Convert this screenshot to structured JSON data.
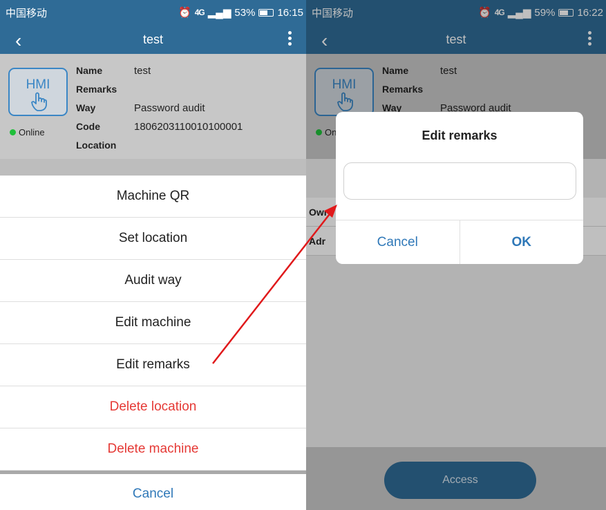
{
  "status_left": {
    "carrier": "中国移动",
    "network": "4G",
    "battery_pct": "53%",
    "battery_level": 0.53,
    "time": "16:15"
  },
  "status_right": {
    "carrier": "中国移动",
    "network": "4G",
    "battery_pct": "59%",
    "battery_level": 0.59,
    "time": "16:22"
  },
  "nav": {
    "title": "test",
    "back_icon": "chevron-left-icon",
    "more_icon": "more-vertical-icon"
  },
  "device": {
    "logo_text": "HMI",
    "status": "Online",
    "fields": [
      {
        "label": "Name",
        "value": "test"
      },
      {
        "label": "Remarks",
        "value": ""
      },
      {
        "label": "Way",
        "value": "Password audit"
      },
      {
        "label": "Code",
        "value": "1806203110010100001"
      },
      {
        "label": "Location",
        "value": ""
      }
    ]
  },
  "menu": {
    "items": [
      {
        "label": "Machine QR",
        "danger": false
      },
      {
        "label": "Set location",
        "danger": false
      },
      {
        "label": "Audit way",
        "danger": false
      },
      {
        "label": "Edit machine",
        "danger": false
      },
      {
        "label": "Edit remarks",
        "danger": false
      },
      {
        "label": "Delete location",
        "danger": true
      },
      {
        "label": "Delete machine",
        "danger": true
      }
    ],
    "cancel": "Cancel"
  },
  "right_rows": {
    "owner": "Owı",
    "admin": "Adr"
  },
  "dialog": {
    "title": "Edit remarks",
    "input_value": "",
    "cancel": "Cancel",
    "ok": "OK"
  },
  "access_button": "Access",
  "colors": {
    "header": "#2f6b96",
    "accent": "#2f78b8",
    "danger": "#e53935",
    "online": "#1fbf3a",
    "arrow": "#e0191b"
  }
}
